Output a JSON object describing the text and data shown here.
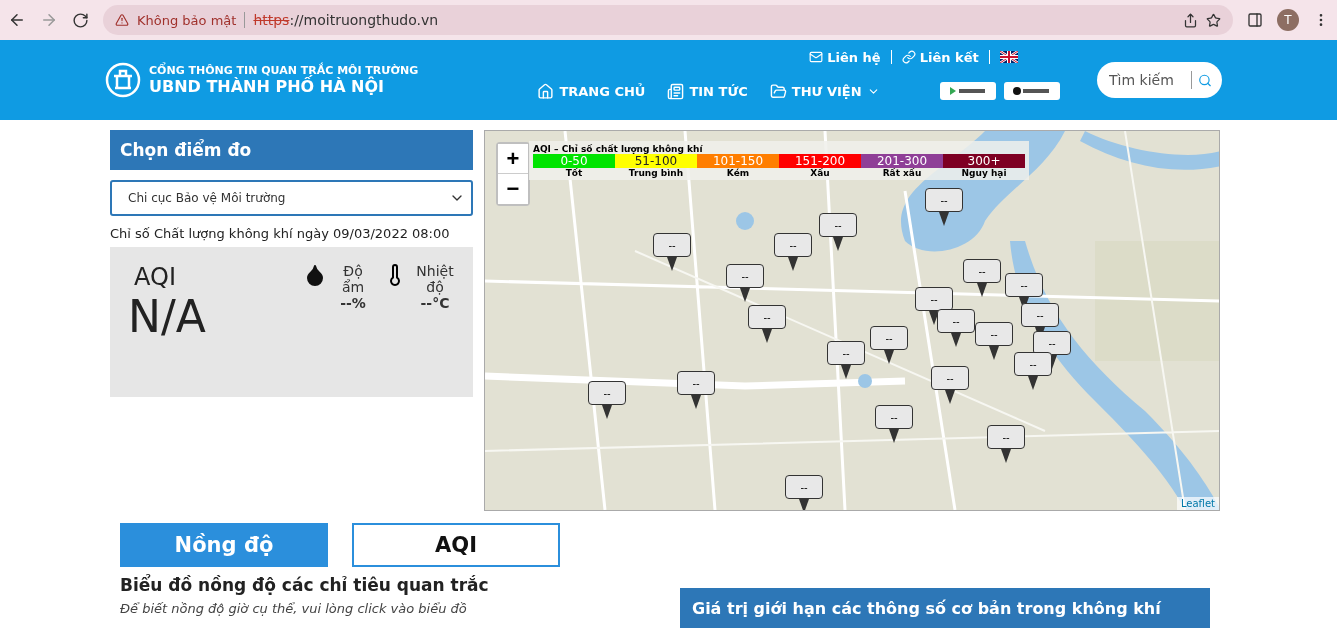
{
  "browser": {
    "security": "Không bảo mật",
    "url_scheme": "https",
    "url_rest": "://moitruongthudo.vn",
    "avatar": "T"
  },
  "header": {
    "title_small": "CỔNG THÔNG TIN QUAN TRẮC MÔI TRƯỜNG",
    "title_big": "UBND THÀNH PHỐ HÀ NỘI",
    "top_links": [
      {
        "label": "Liên hệ"
      },
      {
        "label": "Liên kết"
      }
    ],
    "nav": [
      {
        "label": "TRANG CHỦ",
        "dropdown": false
      },
      {
        "label": "TIN TỨC",
        "dropdown": false
      },
      {
        "label": "THƯ VIỆN",
        "dropdown": true
      }
    ],
    "search": {
      "placeholder": "Tìm kiếm"
    }
  },
  "station_panel": {
    "title": "Chọn điểm đo",
    "select_value": "Chi cục Bảo vệ Môi trường",
    "timestamp": "Chỉ số Chất lượng không khí ngày 09/03/2022 08:00",
    "aqi_label": "AQI",
    "aqi_value": "N/A",
    "humidity": {
      "label": "Độ ẩm",
      "value": "--%"
    },
    "temperature": {
      "label": "Nhiệt độ",
      "value": "--°C"
    }
  },
  "map": {
    "legend_title": "AQI – Chỉ số chất lượng không khí",
    "legend": [
      {
        "range": "0-50",
        "name": "Tốt",
        "color": "#00e400"
      },
      {
        "range": "51-100",
        "name": "Trung bình",
        "color": "#ffff00"
      },
      {
        "range": "101-150",
        "name": "Kém",
        "color": "#ff7e00"
      },
      {
        "range": "151-200",
        "name": "Xấu",
        "color": "#ff0000"
      },
      {
        "range": "201-300",
        "name": "Rất xấu",
        "color": "#8f3f97"
      },
      {
        "range": "300+",
        "name": "Nguy hại",
        "color": "#7e0023"
      }
    ],
    "zoom_in": "+",
    "zoom_out": "−",
    "attribution": "Leaflet",
    "markers": [
      {
        "label": "--"
      },
      {
        "label": "--"
      },
      {
        "label": "--"
      },
      {
        "label": "--"
      },
      {
        "label": "--"
      },
      {
        "label": "--"
      },
      {
        "label": "--"
      },
      {
        "label": "--"
      },
      {
        "label": "--"
      },
      {
        "label": "--"
      },
      {
        "label": "--"
      },
      {
        "label": "--"
      },
      {
        "label": "--"
      },
      {
        "label": "--"
      },
      {
        "label": "--"
      },
      {
        "label": "--"
      },
      {
        "label": "--"
      },
      {
        "label": "--"
      },
      {
        "label": "--"
      },
      {
        "label": "--"
      },
      {
        "label": "--"
      },
      {
        "label": "--"
      }
    ]
  },
  "tabs": [
    {
      "label": "Nồng độ",
      "selected": true
    },
    {
      "label": "AQI",
      "selected": false
    }
  ],
  "chart_section": {
    "title": "Biểu đồ nồng độ các chỉ tiêu quan trắc",
    "hint": "Để biết nồng độ giờ cụ thể, vui lòng click vào biểu đồ"
  },
  "limits_section": {
    "title": "Giá trị giới hạn các thông số cơ bản trong không khí"
  }
}
